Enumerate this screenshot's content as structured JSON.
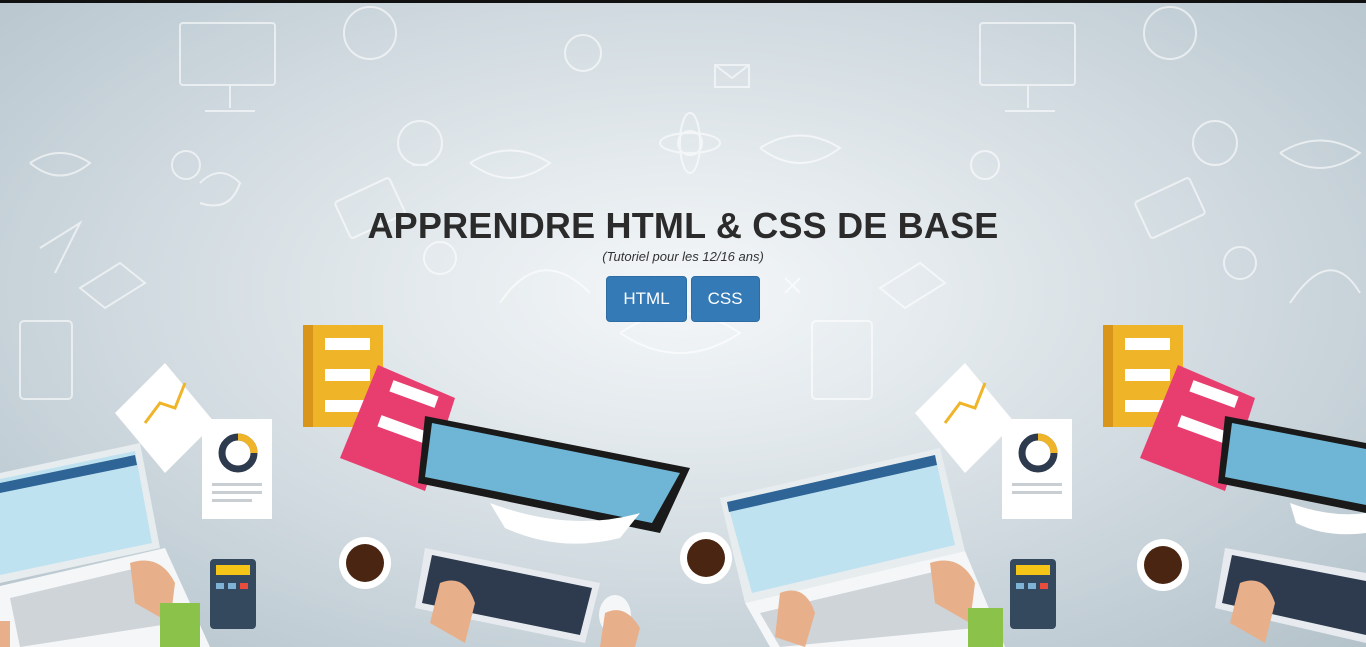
{
  "hero": {
    "title": "APPRENDRE HTML & CSS DE BASE",
    "subtitle": "(Tutoriel pour les 12/16 ans)",
    "buttons": [
      {
        "label": "HTML"
      },
      {
        "label": "CSS"
      }
    ]
  },
  "colors": {
    "button_bg": "#337ab7",
    "title_text": "#2b2b2b",
    "book_yellow": "#f0b429",
    "book_pink": "#e83e6f",
    "screen_blue": "#6fb6d6"
  }
}
